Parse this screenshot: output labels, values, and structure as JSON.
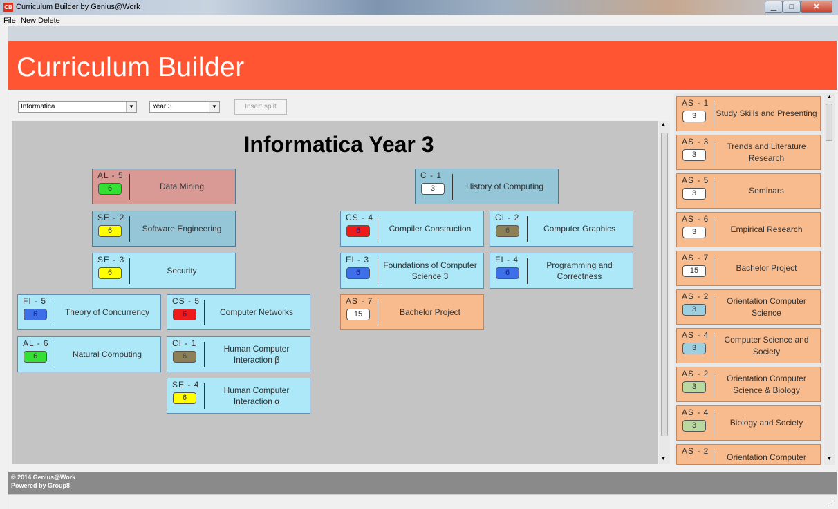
{
  "window": {
    "title": "Curriculum Builder by Genius@Work",
    "icon_text": "CB"
  },
  "menu": {
    "items": [
      "File",
      "New",
      "Delete"
    ]
  },
  "header": {
    "title": "Curriculum Builder"
  },
  "controls": {
    "program": "Informatica",
    "year": "Year 3",
    "insert_split": "Insert split"
  },
  "canvas": {
    "title": "Informatica Year 3",
    "courses": [
      {
        "code": "AL - 5",
        "credits": "6",
        "name": "Data Mining",
        "bg": "#d99a96",
        "badge": "#35e035",
        "highlight": true
      },
      {
        "code": "SE - 2",
        "credits": "6",
        "name": "Software Engineering",
        "bg": "#95c6d8",
        "badge": "#ffff00",
        "highlight": true
      },
      {
        "code": "SE - 3",
        "credits": "6",
        "name": "Security",
        "bg": "#ade8f8",
        "badge": "#ffff00"
      },
      {
        "code": "FI - 5",
        "credits": "6",
        "name": "Theory of Concurrency",
        "bg": "#ade8f8",
        "badge": "#3d6fe8"
      },
      {
        "code": "CS - 5",
        "credits": "6",
        "name": "Computer Networks",
        "bg": "#ade8f8",
        "badge": "#ee1b1b"
      },
      {
        "code": "AL - 6",
        "credits": "6",
        "name": "Natural Computing",
        "bg": "#ade8f8",
        "badge": "#35e035"
      },
      {
        "code": "CI - 1",
        "credits": "6",
        "name": "Human Computer Interaction β",
        "bg": "#ade8f8",
        "badge": "#8d8057"
      },
      {
        "code": "SE - 4",
        "credits": "6",
        "name": "Human Computer Interaction α",
        "bg": "#ade8f8",
        "badge": "#ffff00"
      },
      {
        "code": "C - 1",
        "credits": "3",
        "name": "History of Computing",
        "bg": "#95c6d8",
        "badge": "#ffffff",
        "highlight": true
      },
      {
        "code": "CS - 4",
        "credits": "6",
        "name": "Compiler Construction",
        "bg": "#ade8f8",
        "badge": "#ee1b1b"
      },
      {
        "code": "CI - 2",
        "credits": "6",
        "name": "Computer Graphics",
        "bg": "#ade8f8",
        "badge": "#8d8057"
      },
      {
        "code": "FI - 3",
        "credits": "6",
        "name": "Foundations of Computer Science 3",
        "bg": "#ade8f8",
        "badge": "#3d6fe8"
      },
      {
        "code": "FI - 4",
        "credits": "6",
        "name": "Programming and Correctness",
        "bg": "#ade8f8",
        "badge": "#3d6fe8"
      },
      {
        "code": "AS - 7",
        "credits": "15",
        "name": "Bachelor Project",
        "bg": "#f8bb8e",
        "badge": "#ffffff",
        "orange": true
      }
    ]
  },
  "sidebar": {
    "courses": [
      {
        "code": "AS - 1",
        "credits": "3",
        "name": "Study Skills and Presenting",
        "badge": "#ffffff"
      },
      {
        "code": "AS - 3",
        "credits": "3",
        "name": "Trends and Literature Research",
        "badge": "#ffffff"
      },
      {
        "code": "AS - 5",
        "credits": "3",
        "name": "Seminars",
        "badge": "#ffffff"
      },
      {
        "code": "AS - 6",
        "credits": "3",
        "name": "Empirical Research",
        "badge": "#ffffff"
      },
      {
        "code": "AS - 7",
        "credits": "15",
        "name": "Bachelor Project",
        "badge": "#ffffff"
      },
      {
        "code": "AS - 2",
        "credits": "3",
        "name": "Orientation Computer Science",
        "badge": "#9ccfe0"
      },
      {
        "code": "AS - 4",
        "credits": "3",
        "name": "Computer Science and Society",
        "badge": "#9ccfe0"
      },
      {
        "code": "AS - 2",
        "credits": "3",
        "name": "Orientation Computer Science & Biology",
        "badge": "#b9d9a0"
      },
      {
        "code": "AS - 4",
        "credits": "3",
        "name": "Biology and Society",
        "badge": "#b9d9a0"
      },
      {
        "code": "AS - 2",
        "credits": "",
        "name": "Orientation Computer",
        "badge": "#ffffff"
      }
    ]
  },
  "footer": {
    "line1": "© 2014 Genius@Work",
    "line2": "Powered by Group8"
  }
}
